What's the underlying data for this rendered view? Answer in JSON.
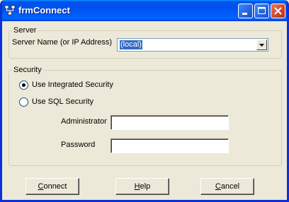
{
  "window": {
    "title": "frmConnect",
    "icons": {
      "app": "network-computers-icon",
      "minimize": "minimize-icon",
      "maximize": "maximize-icon",
      "close": "close-icon"
    }
  },
  "server": {
    "legend": "Server",
    "server_name_label": "Server Name (or IP Address)",
    "server_value": "(local)"
  },
  "security": {
    "legend": "Security",
    "integrated_label": "Use Integrated Security",
    "sql_label": "Use SQL Security",
    "selected": "integrated",
    "administrator_label": "Administrator",
    "administrator_value": "",
    "password_label": "Password",
    "password_value": ""
  },
  "buttons": {
    "connect": {
      "mnemonic": "C",
      "rest": "onnect"
    },
    "help": {
      "mnemonic": "H",
      "rest": "elp"
    },
    "cancel": {
      "mnemonic": "C",
      "rest": "ancel"
    }
  }
}
